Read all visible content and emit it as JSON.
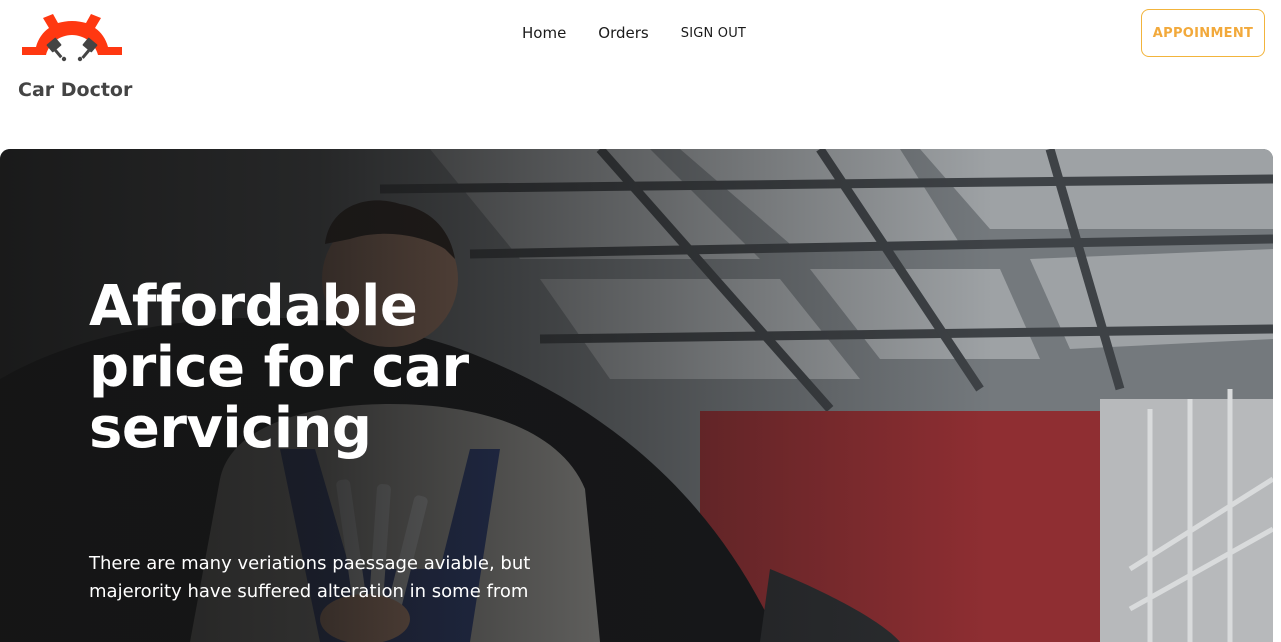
{
  "brand": {
    "name": "Car Doctor",
    "logo_icon": "gear-pistons-icon",
    "accent_color": "#ff3811"
  },
  "nav": {
    "items": [
      {
        "label": "Home"
      },
      {
        "label": "Orders"
      },
      {
        "label": "SIGN OUT"
      }
    ]
  },
  "header": {
    "appointment_label": "APPOINMENT",
    "appointment_color": "#f2a93b"
  },
  "hero": {
    "title": "Affordable price for car servicing",
    "description": "There are many veriations paessage aviable, but majerority have suffered alteration in some from",
    "image": "mechanic-with-wrenches-in-garage"
  }
}
